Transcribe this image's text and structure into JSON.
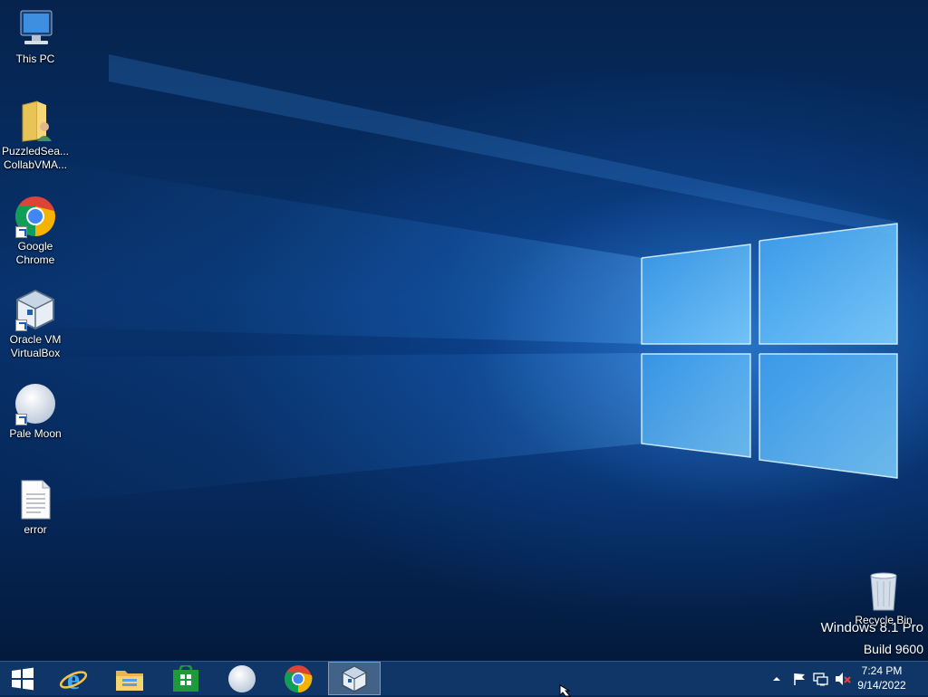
{
  "desktop": {
    "icons": [
      {
        "label": "This PC",
        "icon": "computer-icon",
        "shortcut": false
      },
      {
        "label": "PuzzledSea...\nCollabVMA...",
        "icon": "user-folder-icon",
        "shortcut": false
      },
      {
        "label": "Google\nChrome",
        "icon": "chrome-icon",
        "shortcut": true
      },
      {
        "label": "Oracle VM\nVirtualBox",
        "icon": "virtualbox-icon",
        "shortcut": true
      },
      {
        "label": "Pale Moon",
        "icon": "pale-moon-icon",
        "shortcut": true
      },
      {
        "label": "error",
        "icon": "text-document-icon",
        "shortcut": false
      },
      {
        "label": "Recycle Bin",
        "icon": "recycle-bin-icon",
        "shortcut": false
      }
    ],
    "watermark": {
      "line1": "Windows 8.1 Pro",
      "line2": "Build 9600"
    }
  },
  "taskbar": {
    "start_icon": "windows-start-icon",
    "pinned": [
      {
        "name": "Internet Explorer",
        "icon": "internet-explorer-icon",
        "active": false
      },
      {
        "name": "File Explorer",
        "icon": "file-explorer-icon",
        "active": false
      },
      {
        "name": "Store",
        "icon": "store-icon",
        "active": false
      },
      {
        "name": "Pale Moon",
        "icon": "pale-moon-icon",
        "active": false
      },
      {
        "name": "Google Chrome",
        "icon": "chrome-icon",
        "active": false
      },
      {
        "name": "Oracle VM VirtualBox",
        "icon": "virtualbox-icon",
        "active": true
      }
    ],
    "tray_icons": [
      "show-hidden-icons-icon",
      "action-center-flag-icon",
      "network-icon",
      "volume-muted-icon"
    ],
    "clock": {
      "time": "7:24 PM",
      "date": "9/14/2022"
    }
  },
  "colors": {
    "taskbar": "#0f3666",
    "accent": "#1a73e8",
    "wallpaper_light": "#6fc4ff"
  }
}
